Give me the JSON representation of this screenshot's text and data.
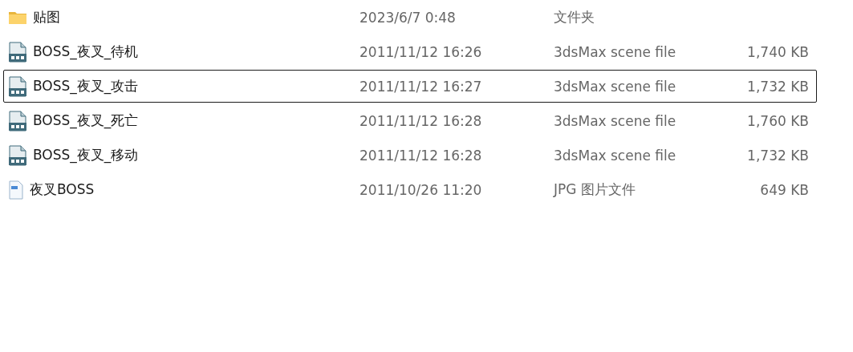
{
  "files": [
    {
      "kind": "folder",
      "name": "贴图",
      "date": "2023/6/7 0:48",
      "type": "文件夹",
      "focused": false
    },
    {
      "kind": "max",
      "name": "BOSS_夜叉_待机",
      "date": "2011/11/12 16:26",
      "type": "3dsMax scene file",
      "size": "1,740 KB",
      "focused": false
    },
    {
      "kind": "max",
      "name": "BOSS_夜叉_攻击",
      "date": "2011/11/12 16:27",
      "type": "3dsMax scene file",
      "size": "1,732 KB",
      "focused": true
    },
    {
      "kind": "max",
      "name": "BOSS_夜叉_死亡",
      "date": "2011/11/12 16:28",
      "type": "3dsMax scene file",
      "size": "1,760 KB",
      "focused": false
    },
    {
      "kind": "max",
      "name": "BOSS_夜叉_移动",
      "date": "2011/11/12 16:28",
      "type": "3dsMax scene file",
      "size": "1,732 KB",
      "focused": false
    },
    {
      "kind": "image",
      "name": "夜叉BOSS",
      "date": "2011/10/26 11:20",
      "type": "JPG 图片文件",
      "size": "649 KB",
      "focused": false
    }
  ]
}
